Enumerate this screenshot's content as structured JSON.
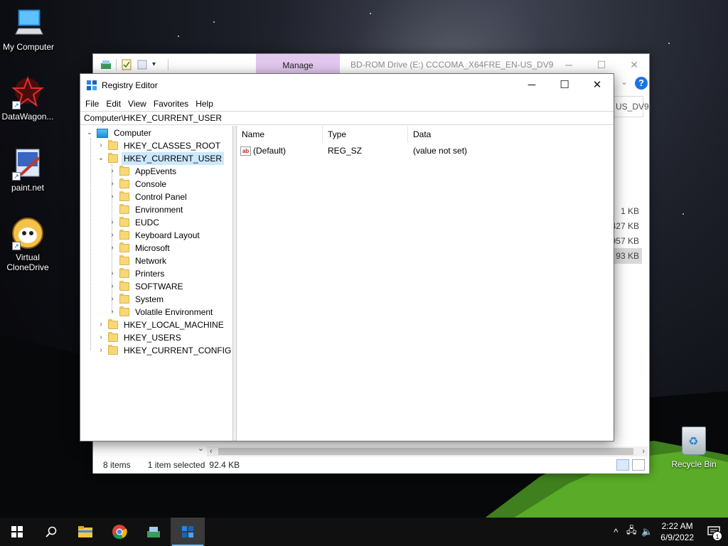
{
  "desktop": {
    "icons": [
      {
        "label": "My Computer"
      },
      {
        "label": "DataWagon..."
      },
      {
        "label": "paint.net"
      },
      {
        "label": "Virtual CloneDrive"
      }
    ],
    "recycle_bin": "Recycle Bin"
  },
  "explorer": {
    "manage_tab": "Manage",
    "title": "BD-ROM Drive (E:) CCCOMA_X64FRE_EN-US_DV9",
    "address_tail": "US_DV9",
    "sizes": [
      "1 KB",
      "427 KB",
      "957 KB",
      "93 KB"
    ],
    "status": {
      "items": "8 items",
      "selected": "1 item selected",
      "size": "92.4 KB"
    }
  },
  "regedit": {
    "title": "Registry Editor",
    "menu": [
      "File",
      "Edit",
      "View",
      "Favorites",
      "Help"
    ],
    "address": "Computer\\HKEY_CURRENT_USER",
    "tree": {
      "root": "Computer",
      "hives": [
        "HKEY_CLASSES_ROOT",
        "HKEY_CURRENT_USER",
        "HKEY_LOCAL_MACHINE",
        "HKEY_USERS",
        "HKEY_CURRENT_CONFIG"
      ],
      "hkcu_children": [
        "AppEvents",
        "Console",
        "Control Panel",
        "Environment",
        "EUDC",
        "Keyboard Layout",
        "Microsoft",
        "Network",
        "Printers",
        "SOFTWARE",
        "System",
        "Volatile Environment"
      ]
    },
    "columns": {
      "name": "Name",
      "type": "Type",
      "data": "Data"
    },
    "values": [
      {
        "name": "(Default)",
        "type": "REG_SZ",
        "data": "(value not set)",
        "icon": "ab"
      }
    ]
  },
  "taskbar": {
    "time": "2:22 AM",
    "date": "6/9/2022",
    "notification_count": "1"
  }
}
